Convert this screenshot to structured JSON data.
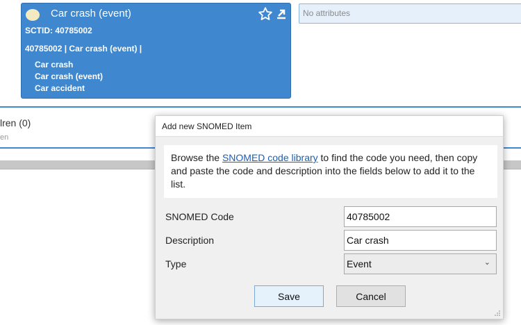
{
  "concept": {
    "title": "Car crash (event)",
    "sctid_line": "SCTID: 40785002",
    "fsn_line": "40785002 | Car crash (event) |",
    "synonyms": [
      "Car crash",
      "Car crash (event)",
      "Car accident"
    ],
    "icons": [
      "star-outline-icon",
      "export-icon"
    ],
    "card_color": "#3f88cf"
  },
  "attributes": {
    "text": "No attributes"
  },
  "children": {
    "title": "lren (0)",
    "subtitle": "en"
  },
  "dialog": {
    "title": "Add new SNOMED Item",
    "info_before": "Browse the ",
    "info_link": "SNOMED code library",
    "info_after": " to find the code you need, then copy and paste the code and description into the fields below to add it to the list.",
    "fields": {
      "code_label": "SNOMED Code",
      "code_value": "40785002",
      "description_label": "Description",
      "description_value": "Car crash",
      "type_label": "Type",
      "type_value": "Event"
    },
    "save_label": "Save",
    "cancel_label": "Cancel"
  }
}
